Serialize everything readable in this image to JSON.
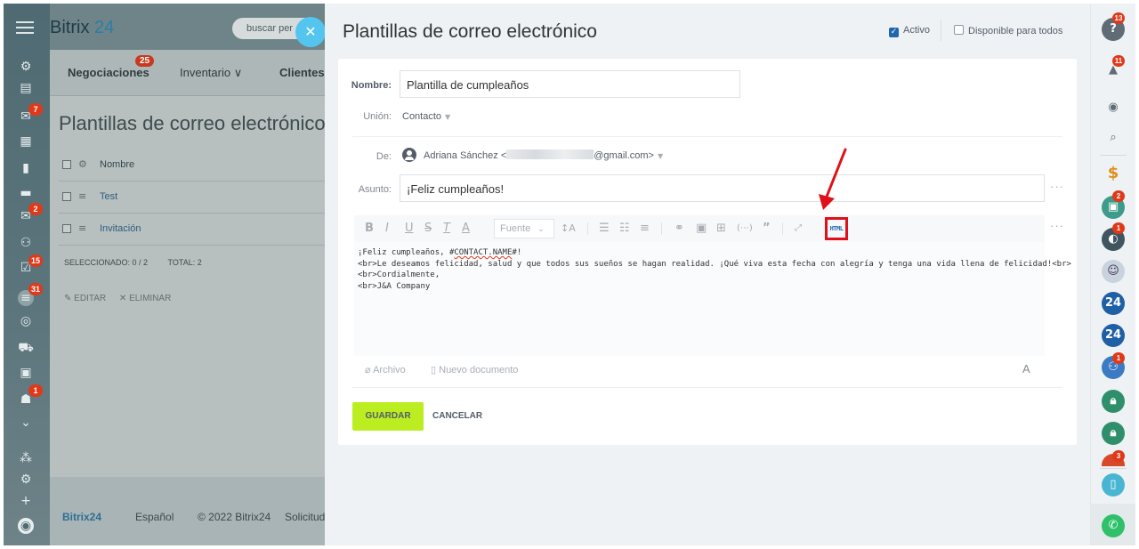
{
  "background": {
    "brand_name": "Bitrix",
    "brand_suffix": "24",
    "search_placeholder": "buscar per",
    "nav_tabs": [
      {
        "label": "Negociaciones",
        "badge": "25"
      },
      {
        "label": "Inventario ∨"
      },
      {
        "label": "Clientes"
      }
    ],
    "page_title": "Plantillas de correo electrónico",
    "header_column": "Nombre",
    "rows": [
      "Test",
      "Invitación"
    ],
    "selected_label": "SELECCIONADO: 0 / 2",
    "total_label": "TOTAL: 2",
    "edit_label": "EDITAR",
    "delete_label": "ELIMINAR",
    "footer": {
      "brand": "Bitrix24",
      "language": "Español",
      "copyright": "© 2022 Bitrix24",
      "request": "Solicitud"
    },
    "left_badges": [
      "7",
      "2",
      "15",
      "31",
      "1"
    ]
  },
  "panel": {
    "title": "Plantillas de correo electrónico",
    "active_label": "Activo",
    "available_label": "Disponible para todos",
    "name_label": "Nombre:",
    "name_value": "Plantilla de cumpleaños",
    "union_label": "Unión:",
    "union_value": "Contacto",
    "from_label": "De:",
    "from_name": "Adriana Sánchez <",
    "from_domain": "@gmail.com>",
    "subject_label": "Asunto:",
    "subject_value": "¡Feliz cumpleaños!",
    "font_select": "Fuente",
    "html_button": "HTML",
    "body_lines": [
      "¡Feliz cumpleaños, #CONTACT.NAME#!",
      "<br>Le deseamos felicidad, salud y que todos sus sueños se hagan realidad. ¡Qué viva esta fecha con alegría y tenga una vida llena de felicidad!<br>",
      "<br>Cordialmente,",
      "<br>J&A Company"
    ],
    "attach_file": "Archivo",
    "new_document": "Nuevo documento",
    "save_label": "GUARDAR",
    "cancel_label": "CANCELAR"
  },
  "right_badges": {
    "help": "13",
    "bell": "11",
    "app": "2",
    "user1": "1",
    "group": "1",
    "last": "3"
  },
  "colors": {
    "save_button": "#bbed21",
    "close_button": "#53c5ee",
    "highlight": "#e0101a",
    "badge": "#e0391a"
  }
}
